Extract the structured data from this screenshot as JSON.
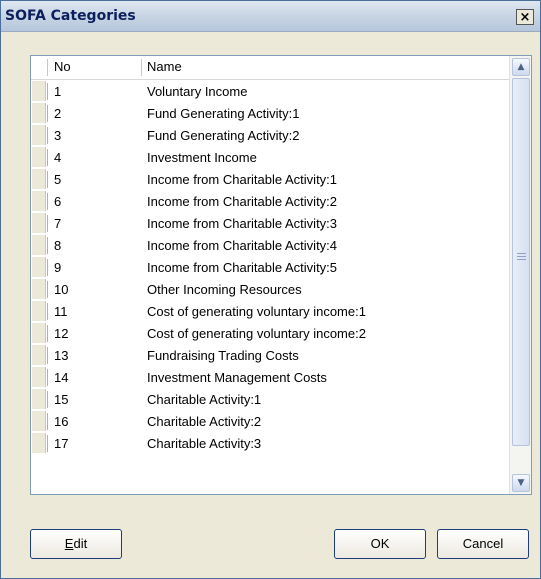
{
  "window": {
    "title": "SOFA Categories",
    "close_label": "×"
  },
  "grid": {
    "columns": [
      "No",
      "Name"
    ],
    "rows": [
      {
        "no": "1",
        "name": "Voluntary Income"
      },
      {
        "no": "2",
        "name": "Fund Generating Activity:1"
      },
      {
        "no": "3",
        "name": "Fund Generating Activity:2"
      },
      {
        "no": "4",
        "name": "Investment Income"
      },
      {
        "no": "5",
        "name": "Income from Charitable Activity:1"
      },
      {
        "no": "6",
        "name": "Income from Charitable Activity:2"
      },
      {
        "no": "7",
        "name": "Income from Charitable Activity:3"
      },
      {
        "no": "8",
        "name": "Income from Charitable Activity:4"
      },
      {
        "no": "9",
        "name": "Income from Charitable Activity:5"
      },
      {
        "no": "10",
        "name": "Other Incoming Resources"
      },
      {
        "no": "11",
        "name": "Cost of generating voluntary income:1"
      },
      {
        "no": "12",
        "name": "Cost of generating voluntary income:2"
      },
      {
        "no": "13",
        "name": "Fundraising Trading Costs"
      },
      {
        "no": "14",
        "name": "Investment Management Costs"
      },
      {
        "no": "15",
        "name": "Charitable Activity:1"
      },
      {
        "no": "16",
        "name": "Charitable Activity:2"
      },
      {
        "no": "17",
        "name": "Charitable Activity:3"
      }
    ]
  },
  "buttons": {
    "edit_mnemonic": "E",
    "edit_rest": "dit",
    "ok_label": "OK",
    "cancel_label": "Cancel"
  },
  "icons": {
    "close": "close-icon",
    "scroll_up": "chevron-up-icon",
    "scroll_down": "chevron-down-icon",
    "grip": "scroll-grip-icon"
  }
}
